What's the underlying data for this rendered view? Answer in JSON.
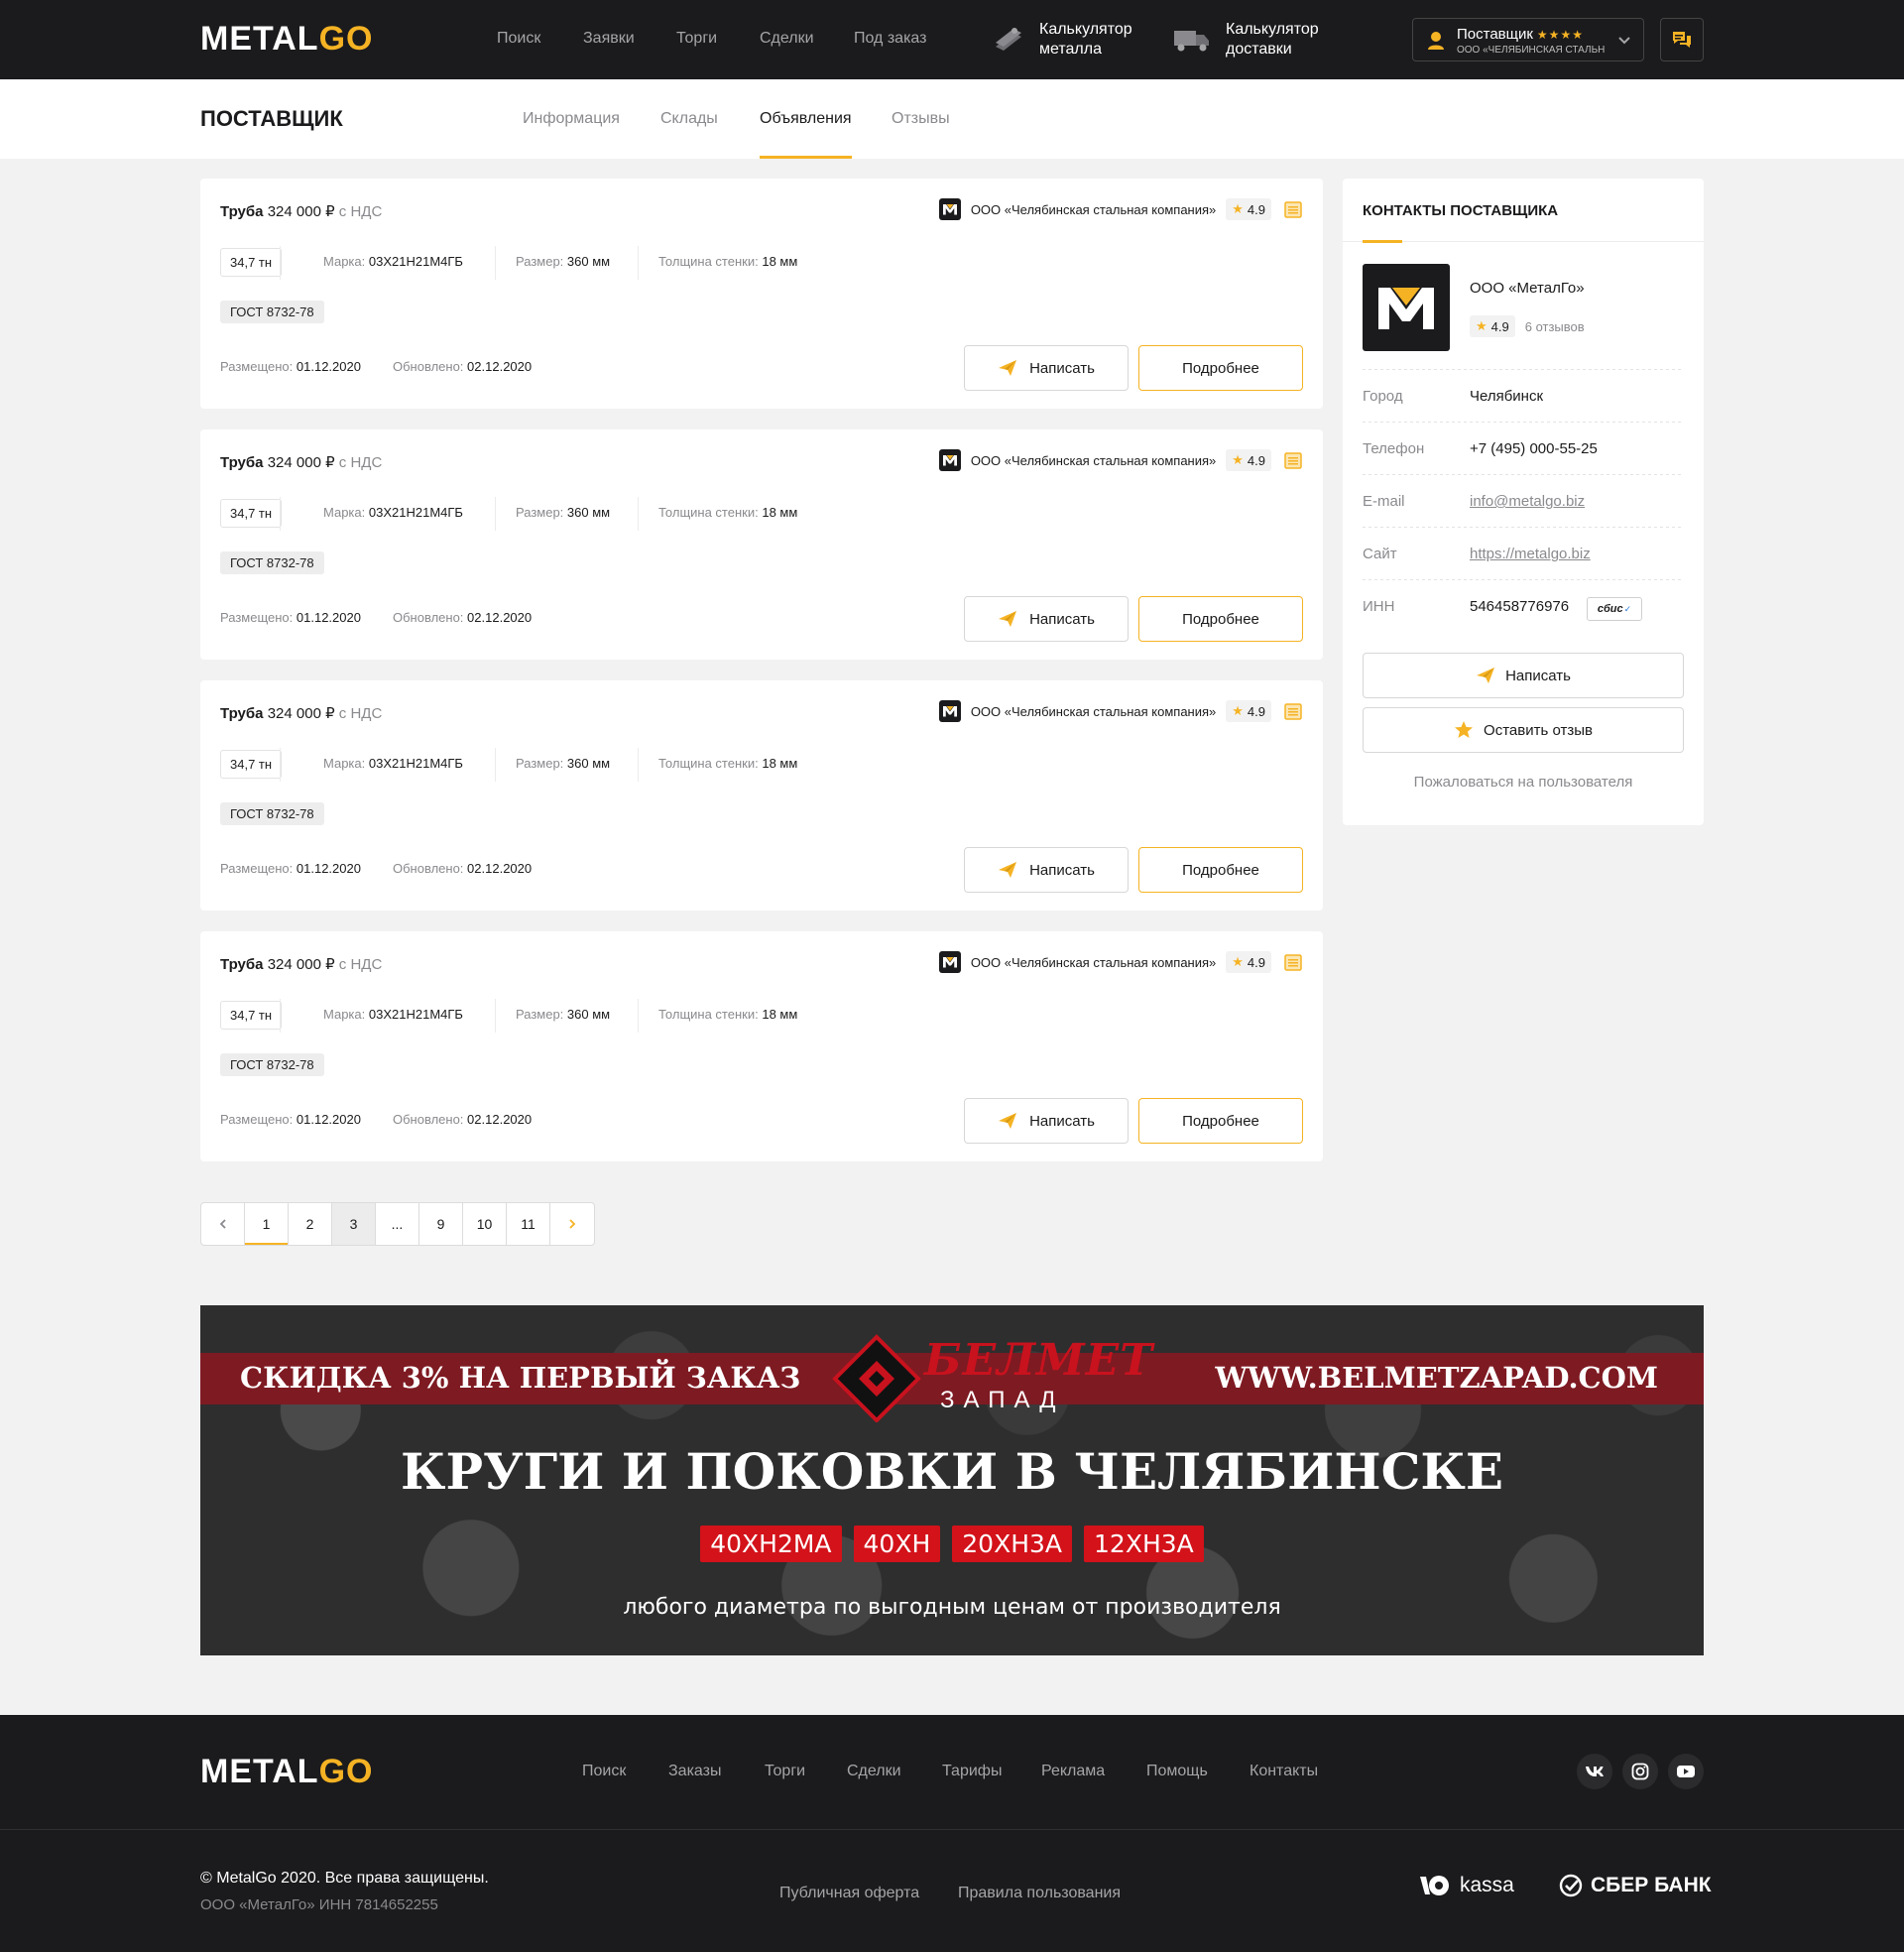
{
  "header": {
    "logo_part1": "METAL",
    "logo_part2": "GO",
    "nav": [
      "Поиск",
      "Заявки",
      "Торги",
      "Сделки",
      "Под заказ"
    ],
    "calc_metal": [
      "Калькулятор",
      "металла"
    ],
    "calc_delivery": [
      "Калькулятор",
      "доставки"
    ],
    "user": {
      "role": "Поставщик",
      "stars": "★★★★",
      "company": "ООО «ЧЕЛЯБИНСКАЯ СТАЛЬН..."
    }
  },
  "subheader": {
    "title": "ПОСТАВЩИК",
    "tabs": [
      "Информация",
      "Склады",
      "Объявления",
      "Отзывы"
    ],
    "active_tab": "Объявления"
  },
  "listings": [
    {
      "product": "Труба",
      "price": "324 000 ₽",
      "vat": "с НДС",
      "seller": "ООО «Челябинская стальная компания»",
      "rating": "4.9",
      "qty": "34,7 тн",
      "grade_label": "Марка:",
      "grade": "03Х21Н21М4ГБ",
      "size_label": "Размер:",
      "size": "360 мм",
      "wall_label": "Толщина стенки:",
      "wall": "18 мм",
      "gost": "ГОСТ 8732-78",
      "posted_label": "Размещено:",
      "posted": "01.12.2020",
      "updated_label": "Обновлено:",
      "updated": "02.12.2020",
      "write": "Написать",
      "more": "Подробнее"
    },
    {
      "product": "Труба",
      "price": "324 000 ₽",
      "vat": "с НДС",
      "seller": "ООО «Челябинская стальная компания»",
      "rating": "4.9",
      "qty": "34,7 тн",
      "grade_label": "Марка:",
      "grade": "03Х21Н21М4ГБ",
      "size_label": "Размер:",
      "size": "360 мм",
      "wall_label": "Толщина стенки:",
      "wall": "18 мм",
      "gost": "ГОСТ 8732-78",
      "posted_label": "Размещено:",
      "posted": "01.12.2020",
      "updated_label": "Обновлено:",
      "updated": "02.12.2020",
      "write": "Написать",
      "more": "Подробнее"
    },
    {
      "product": "Труба",
      "price": "324 000 ₽",
      "vat": "с НДС",
      "seller": "ООО «Челябинская стальная компания»",
      "rating": "4.9",
      "qty": "34,7 тн",
      "grade_label": "Марка:",
      "grade": "03Х21Н21М4ГБ",
      "size_label": "Размер:",
      "size": "360 мм",
      "wall_label": "Толщина стенки:",
      "wall": "18 мм",
      "gost": "ГОСТ 8732-78",
      "posted_label": "Размещено:",
      "posted": "01.12.2020",
      "updated_label": "Обновлено:",
      "updated": "02.12.2020",
      "write": "Написать",
      "more": "Подробнее"
    },
    {
      "product": "Труба",
      "price": "324 000 ₽",
      "vat": "с НДС",
      "seller": "ООО «Челябинская стальная компания»",
      "rating": "4.9",
      "qty": "34,7 тн",
      "grade_label": "Марка:",
      "grade": "03Х21Н21М4ГБ",
      "size_label": "Размер:",
      "size": "360 мм",
      "wall_label": "Толщина стенки:",
      "wall": "18 мм",
      "gost": "ГОСТ 8732-78",
      "posted_label": "Размещено:",
      "posted": "01.12.2020",
      "updated_label": "Обновлено:",
      "updated": "02.12.2020",
      "write": "Написать",
      "more": "Подробнее"
    }
  ],
  "pagination": {
    "pages": [
      "1",
      "2",
      "3",
      "...",
      "9",
      "10",
      "11"
    ],
    "current": "1",
    "highlighted": "3"
  },
  "contacts": {
    "title": "КОНТАКТЫ ПОСТАВЩИКА",
    "company": "ООО «МеталГо»",
    "rating": "4.9",
    "reviews": "6 отзывов",
    "rows": [
      {
        "label": "Город",
        "value": "Челябинск"
      },
      {
        "label": "Телефон",
        "value": "+7 (495) 000-55-25"
      },
      {
        "label": "E-mail",
        "value": "info@metalgo.biz"
      },
      {
        "label": "Сайт",
        "value": "https://metalgo.biz"
      },
      {
        "label": "ИНН",
        "value": "546458776976"
      }
    ],
    "check_badge": "сбис",
    "write": "Написать",
    "review": "Оставить отзыв",
    "report": "Пожаловаться на пользователя"
  },
  "banner": {
    "promo_left": "СКИДКА 3% НА ПЕРВЫЙ ЗАКАЗ",
    "promo_right": "WWW.BELMETZAPAD.COM",
    "brand": "БЕЛМЕТ",
    "brand_sub": "ЗАПАД",
    "headline": "КРУГИ И ПОКОВКИ В ЧЕЛЯБИНСКЕ",
    "grades": [
      "40ХН2МА",
      "40ХН",
      "20ХН3А",
      "12ХН3А"
    ],
    "tagline": "любого диаметра по выгодным ценам от производителя"
  },
  "footer": {
    "nav": [
      "Поиск",
      "Заказы",
      "Торги",
      "Сделки",
      "Тарифы",
      "Реклама",
      "Помощь",
      "Контакты"
    ],
    "social": [
      "vk-icon",
      "instagram-icon",
      "youtube-icon"
    ],
    "copyright": "© MetalGo 2020. Все права защищены.",
    "legal": "ООО «МеталГо» ИНН 7814652255",
    "links": [
      "Публичная оферта",
      "Правила пользования"
    ],
    "payments": [
      "kassa",
      "СБЕР БАНК"
    ]
  },
  "colors": {
    "accent": "#f5b324",
    "dark": "#1b1b1d",
    "banner_red": "#d3121a"
  }
}
